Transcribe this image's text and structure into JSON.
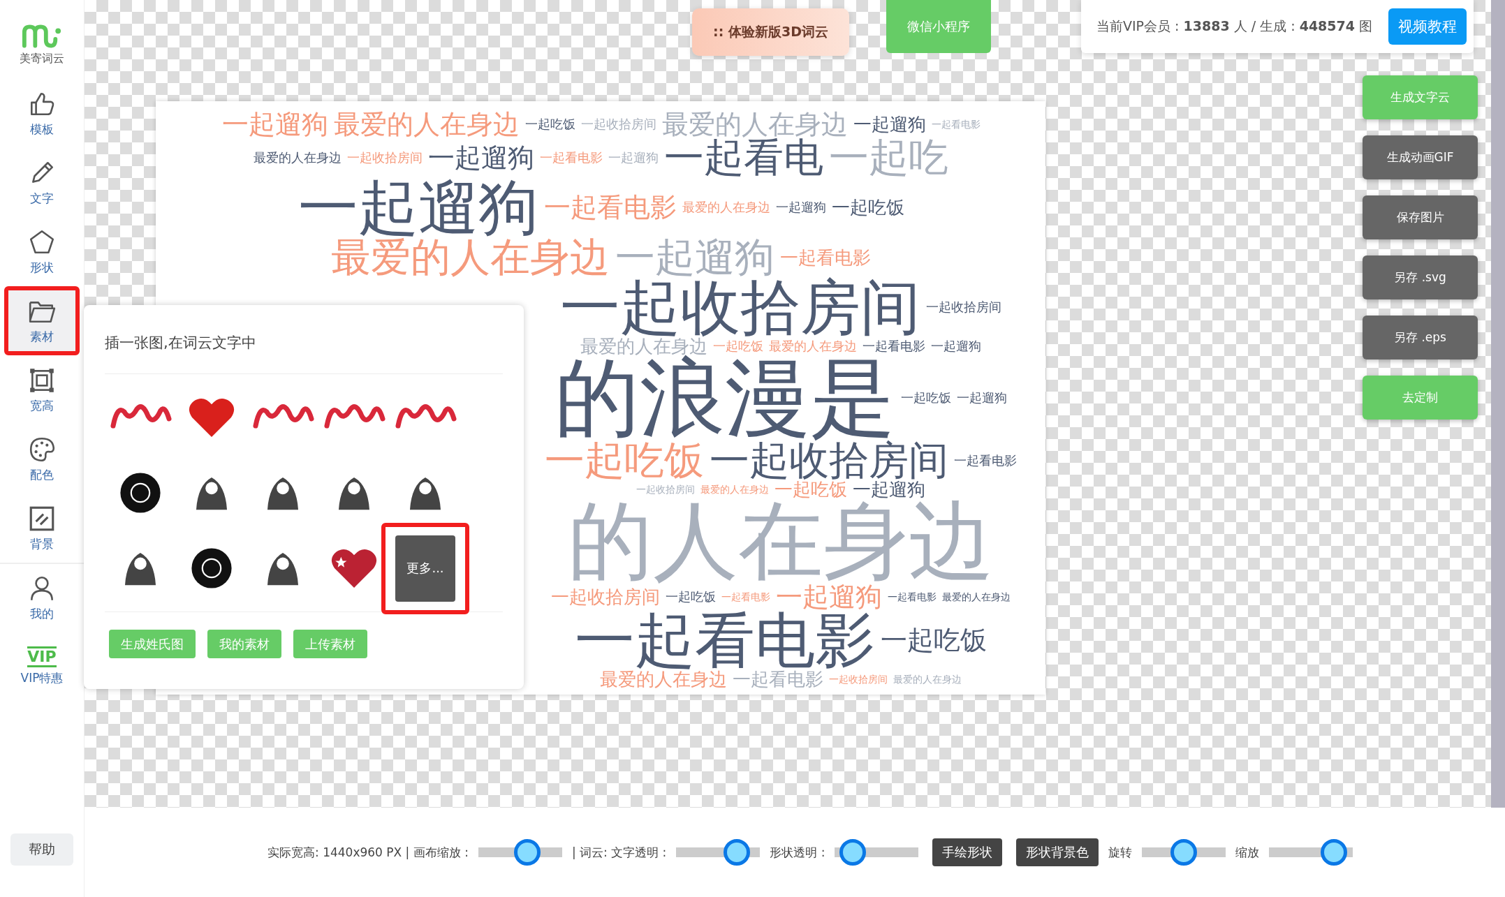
{
  "sidebar": {
    "logo": "美寄词云",
    "items": [
      {
        "label": "模板",
        "kind": "template",
        "selected": false
      },
      {
        "label": "文字",
        "kind": "text",
        "selected": false
      },
      {
        "label": "形状",
        "kind": "shape",
        "selected": false
      },
      {
        "label": "素材",
        "kind": "material",
        "selected": true
      },
      {
        "label": "宽高",
        "kind": "size",
        "selected": false
      },
      {
        "label": "配色",
        "kind": "color",
        "selected": false
      },
      {
        "label": "背景",
        "kind": "background",
        "selected": false
      },
      {
        "label": "我的",
        "kind": "mine",
        "selected": false
      },
      {
        "label": "VIP特惠",
        "kind": "vip",
        "badge": "VIP",
        "selected": false
      }
    ],
    "help": "帮助"
  },
  "top": {
    "try_3d": "::  体验新版3D词云",
    "mini_program": "微信小程序",
    "stats": "当前VIP会员 : **13883** 人 / 生成 : **448574** 图",
    "tutorial": "视频教程"
  },
  "actions": [
    {
      "label": "生成文字云",
      "kind": "primary"
    },
    {
      "label": "生成动画GIF",
      "kind": "secondary"
    },
    {
      "label": "保存图片",
      "kind": "secondary"
    },
    {
      "label": "另存 .svg",
      "kind": "secondary"
    },
    {
      "label": "另存 .eps",
      "kind": "secondary"
    },
    {
      "label": "去定制",
      "kind": "primary"
    }
  ],
  "word_cloud": {
    "words": [
      {
        "text": "一起遛狗",
        "kind": "medium",
        "color": "#f59a7c"
      },
      {
        "text": "最爱的人在身边",
        "kind": "medium",
        "color": "#f59a7c"
      },
      {
        "text": "一起吃饭",
        "kind": "small",
        "color": "#4e5b73"
      },
      {
        "text": "一起收拾房间",
        "kind": "small",
        "color": "#a8b0bc"
      },
      {
        "text": "最爱的人在身边",
        "kind": "medium",
        "color": "#a8b0bc"
      },
      {
        "text": "一起遛狗",
        "kind": "compact",
        "color": "#4e5b73"
      },
      {
        "text": "一起看电影",
        "kind": "tiny",
        "color": "#a8b0bc"
      },
      {
        "text": "最爱的人在身边",
        "kind": "small",
        "color": "#4e5b73"
      },
      {
        "text": "一起收拾房间",
        "kind": "small",
        "color": "#f59a7c"
      },
      {
        "text": "一起遛狗",
        "kind": "medium",
        "color": "#4e5b73"
      },
      {
        "text": "一起看电影",
        "kind": "small",
        "color": "#f59a7c"
      },
      {
        "text": "一起遛狗",
        "kind": "small",
        "color": "#a8b0bc"
      },
      {
        "text": "一起看电",
        "kind": "large",
        "color": "#4e5b73"
      },
      {
        "text": "一起吃",
        "kind": "large",
        "color": "#a8b0bc"
      },
      {
        "text": "一起遛狗",
        "kind": "huge",
        "color": "#4e5b73"
      },
      {
        "text": "一起看电影",
        "kind": "medium",
        "color": "#f59a7c"
      },
      {
        "text": "最爱的人在身边",
        "kind": "small",
        "color": "#f59a7c"
      },
      {
        "text": "一起遛狗",
        "kind": "small",
        "color": "#4e5b73"
      },
      {
        "text": "一起吃饭",
        "kind": "compact",
        "color": "#4e5b73"
      },
      {
        "text": "最爱的人在身边",
        "kind": "large",
        "color": "#f59a7c"
      },
      {
        "text": "一起遛狗",
        "kind": "large",
        "color": "#a8b0bc"
      },
      {
        "text": "一起看电影",
        "kind": "compact",
        "color": "#f59a7c"
      },
      {
        "text": "一起收拾房间",
        "kind": "huge",
        "color": "#4e5b73"
      },
      {
        "text": "一起收拾房间",
        "kind": "small",
        "color": "#4e5b73"
      },
      {
        "text": "最爱的人在身边",
        "kind": "compact",
        "color": "#a8b0bc"
      },
      {
        "text": "一起吃饭",
        "kind": "small",
        "color": "#f59a7c"
      },
      {
        "text": "最爱的人在身边",
        "kind": "small",
        "color": "#f59a7c"
      },
      {
        "text": "一起看电影",
        "kind": "small",
        "color": "#4e5b73"
      },
      {
        "text": "一起遛狗",
        "kind": "small",
        "color": "#4e5b73"
      },
      {
        "text": "的浪漫是",
        "kind": "giant",
        "color": "#4e5b73"
      },
      {
        "text": "一起吃饭",
        "kind": "small",
        "color": "#4e5b73"
      },
      {
        "text": "一起遛狗",
        "kind": "small",
        "color": "#4e5b73"
      },
      {
        "text": "一起吃饭",
        "kind": "large",
        "color": "#f59a7c"
      },
      {
        "text": "一起收拾房间",
        "kind": "large",
        "color": "#4e5b73"
      },
      {
        "text": "一起看电影",
        "kind": "small",
        "color": "#4e5b73"
      },
      {
        "text": "一起收拾房间",
        "kind": "tiny",
        "color": "#a8b0bc"
      },
      {
        "text": "最爱的人在身边",
        "kind": "tiny",
        "color": "#f59a7c"
      },
      {
        "text": "一起吃饭",
        "kind": "compact",
        "color": "#f59a7c"
      },
      {
        "text": "一起遛狗",
        "kind": "compact",
        "color": "#4e5b73"
      },
      {
        "text": "的人在身边",
        "kind": "giant",
        "color": "#a8b0bc"
      },
      {
        "text": "一起收拾房间",
        "kind": "compact",
        "color": "#f59a7c"
      },
      {
        "text": "一起吃饭",
        "kind": "small",
        "color": "#4e5b73"
      },
      {
        "text": "一起看电影",
        "kind": "tiny",
        "color": "#f59a7c"
      },
      {
        "text": "一起遛狗",
        "kind": "medium",
        "color": "#f59a7c"
      },
      {
        "text": "一起看电影",
        "kind": "tiny",
        "color": "#4e5b73"
      },
      {
        "text": "最爱的人在身边",
        "kind": "tiny",
        "color": "#4e5b73"
      },
      {
        "text": "一起看电影",
        "kind": "huge",
        "color": "#4e5b73"
      },
      {
        "text": "一起吃饭",
        "kind": "medium",
        "color": "#4e5b73"
      },
      {
        "text": "最爱的人在身边",
        "kind": "compact",
        "color": "#f59a7c"
      },
      {
        "text": "一起看电影",
        "kind": "compact",
        "color": "#a8b0bc"
      },
      {
        "text": "一起收拾房间",
        "kind": "tiny",
        "color": "#f59a7c"
      },
      {
        "text": "最爱的人在身边",
        "kind": "tiny",
        "color": "#a8b0bc"
      }
    ]
  },
  "material_panel": {
    "title": "插一张图,在词云文字中",
    "materials": [
      {
        "kind": "red-art"
      },
      {
        "kind": "heart"
      },
      {
        "kind": "red-art"
      },
      {
        "kind": "red-art"
      },
      {
        "kind": "red-art"
      },
      {
        "kind": "ink-circle"
      },
      {
        "kind": "ink-art"
      },
      {
        "kind": "ink-art"
      },
      {
        "kind": "ink-art"
      },
      {
        "kind": "ink-art"
      },
      {
        "kind": "ink-art"
      },
      {
        "kind": "ink-circle"
      },
      {
        "kind": "ink-art"
      },
      {
        "kind": "star-heart"
      }
    ],
    "more": {
      "label": "更多...",
      "highlighted": true
    },
    "buttons": [
      "生成姓氏图",
      "我的素材",
      "上传素材"
    ]
  },
  "bottom_bar": [
    {
      "kind": "text",
      "text": "实际宽高: 1440x960 PX | 画布缩放 :"
    },
    {
      "kind": "slider",
      "level": 0.62
    },
    {
      "kind": "text",
      "text": "| 词云: 文字透明 :"
    },
    {
      "kind": "slider",
      "level": 0.82
    },
    {
      "kind": "text",
      "text": "形状透明 :"
    },
    {
      "kind": "slider",
      "level": 0.08
    },
    {
      "kind": "button",
      "text": "手绘形状"
    },
    {
      "kind": "button",
      "text": "形状背景色"
    },
    {
      "kind": "text",
      "text": "旋转"
    },
    {
      "kind": "slider",
      "level": 0.5
    },
    {
      "kind": "text",
      "text": "缩放"
    },
    {
      "kind": "slider",
      "level": 0.9
    }
  ]
}
